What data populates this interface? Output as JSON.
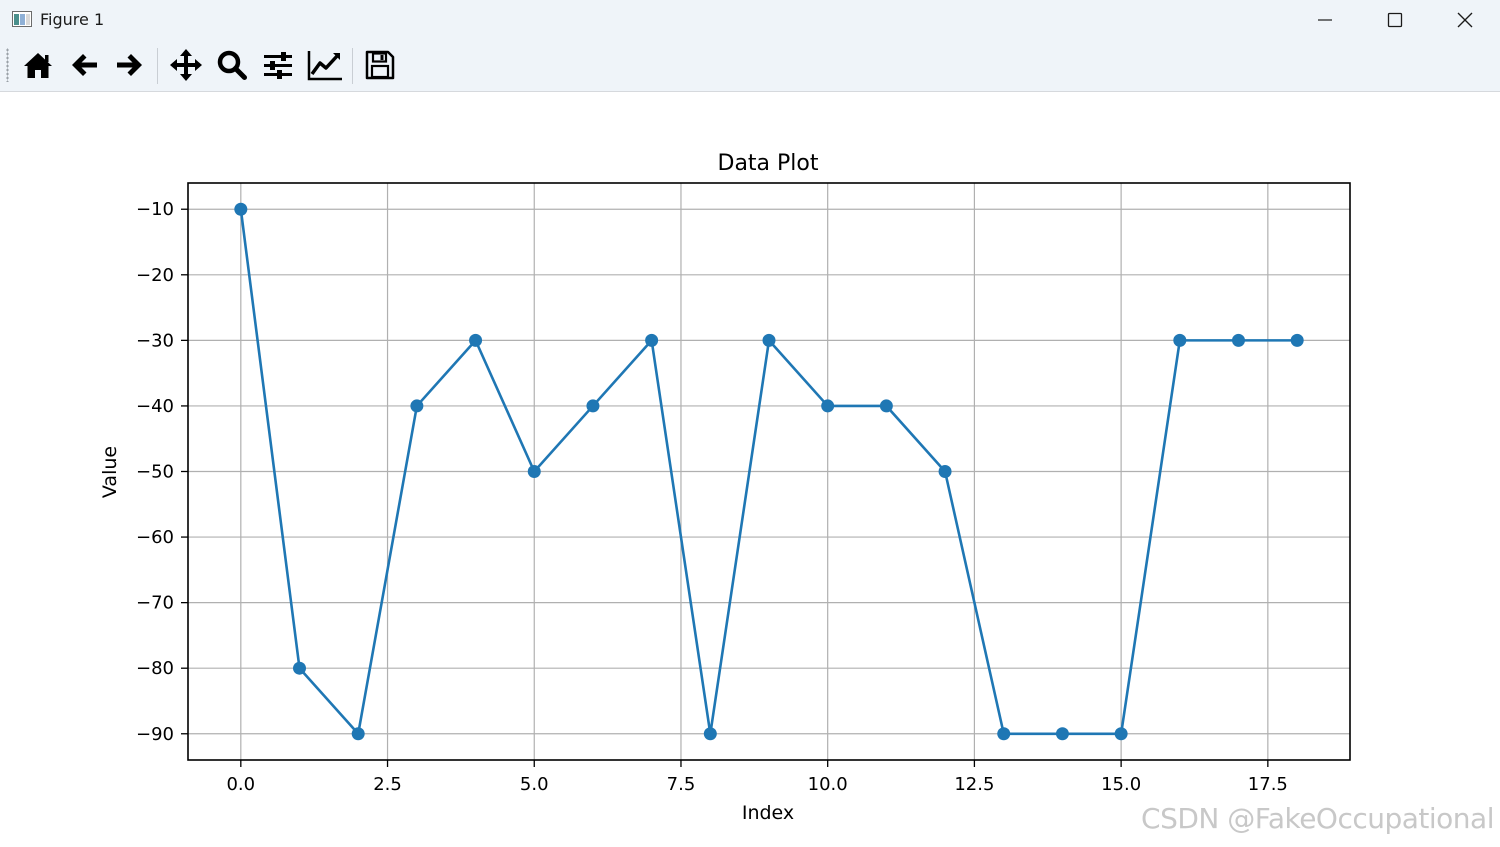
{
  "window": {
    "title": "Figure 1",
    "icon": "matplotlib-figure-icon",
    "controls": [
      "minimize-icon",
      "maximize-icon",
      "close-icon"
    ]
  },
  "toolbar": {
    "buttons": [
      {
        "name": "home-icon",
        "tooltip": "Home"
      },
      {
        "name": "back-arrow-icon",
        "tooltip": "Back"
      },
      {
        "name": "forward-arrow-icon",
        "tooltip": "Forward"
      },
      {
        "name": "pan-move-icon",
        "tooltip": "Pan"
      },
      {
        "name": "zoom-magnifier-icon",
        "tooltip": "Zoom"
      },
      {
        "name": "configure-subplots-icon",
        "tooltip": "Subplots"
      },
      {
        "name": "edit-axes-icon",
        "tooltip": "Customize"
      },
      {
        "name": "save-floppy-icon",
        "tooltip": "Save"
      }
    ]
  },
  "watermark": "CSDN @FakeOccupational",
  "colors": {
    "line": "#1f77b4",
    "grid": "#b0b0b0",
    "chrome": "#eff4f9"
  },
  "chart_data": {
    "type": "line",
    "title": "Data Plot",
    "xlabel": "Index",
    "ylabel": "Value",
    "grid": true,
    "marker": "circle",
    "x": [
      0,
      1,
      2,
      3,
      4,
      5,
      6,
      7,
      8,
      9,
      10,
      11,
      12,
      13,
      14,
      15,
      16,
      17,
      18
    ],
    "series": [
      {
        "values": [
          -10,
          -80,
          -90,
          -40,
          -30,
          -50,
          -40,
          -30,
          -90,
          -30,
          -40,
          -40,
          -50,
          -90,
          -90,
          -90,
          -30,
          -30,
          -30
        ]
      }
    ],
    "xlim": [
      -0.9,
      18.9
    ],
    "ylim": [
      -94,
      -6
    ],
    "xticks": [
      0.0,
      2.5,
      5.0,
      7.5,
      10.0,
      12.5,
      15.0,
      17.5
    ],
    "xtick_labels": [
      "0.0",
      "2.5",
      "5.0",
      "7.5",
      "10.0",
      "12.5",
      "15.0",
      "17.5"
    ],
    "yticks": [
      -10,
      -20,
      -30,
      -40,
      -50,
      -60,
      -70,
      -80,
      -90
    ],
    "ytick_labels": [
      "−10",
      "−20",
      "−30",
      "−40",
      "−50",
      "−60",
      "−70",
      "−80",
      "−90"
    ]
  }
}
